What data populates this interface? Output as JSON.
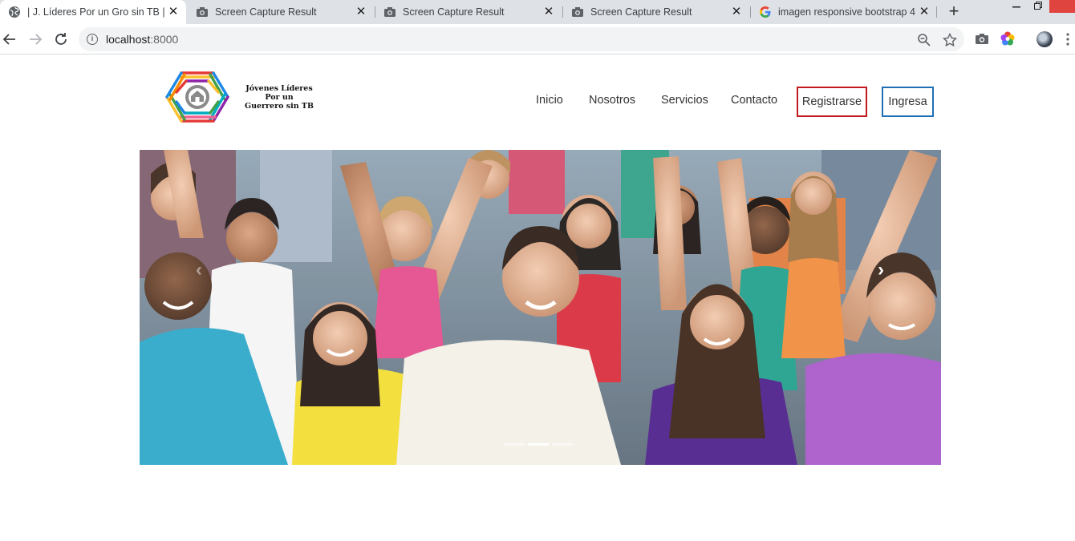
{
  "browser": {
    "tabs": [
      {
        "title": "| J. Líderes Por un Gro sin TB |",
        "icon": "globe-icon",
        "active": true
      },
      {
        "title": "Screen Capture Result",
        "icon": "camera-icon",
        "active": false
      },
      {
        "title": "Screen Capture Result",
        "icon": "camera-icon",
        "active": false
      },
      {
        "title": "Screen Capture Result",
        "icon": "camera-icon",
        "active": false
      },
      {
        "title": "imagen responsive bootstrap 4",
        "icon": "google-icon",
        "active": false
      }
    ],
    "close_glyph": "✕",
    "new_tab_glyph": "+",
    "address": {
      "host": "localhost",
      "port": ":8000"
    }
  },
  "site": {
    "logo_lines": [
      "Jóvenes Líderes",
      "Por un",
      "Guerrero sin TB"
    ],
    "nav": {
      "inicio": "Inicio",
      "nosotros": "Nosotros",
      "servicios": "Servicios",
      "contacto": "Contacto",
      "register": "Registrarse",
      "login": "Ingresa"
    },
    "carousel": {
      "prev_glyph": "‹",
      "next_glyph": "›",
      "slide_count": 3,
      "active_slide": 2
    }
  },
  "colors": {
    "register_border": "#c2191e",
    "login_border": "#1f6fb4"
  }
}
